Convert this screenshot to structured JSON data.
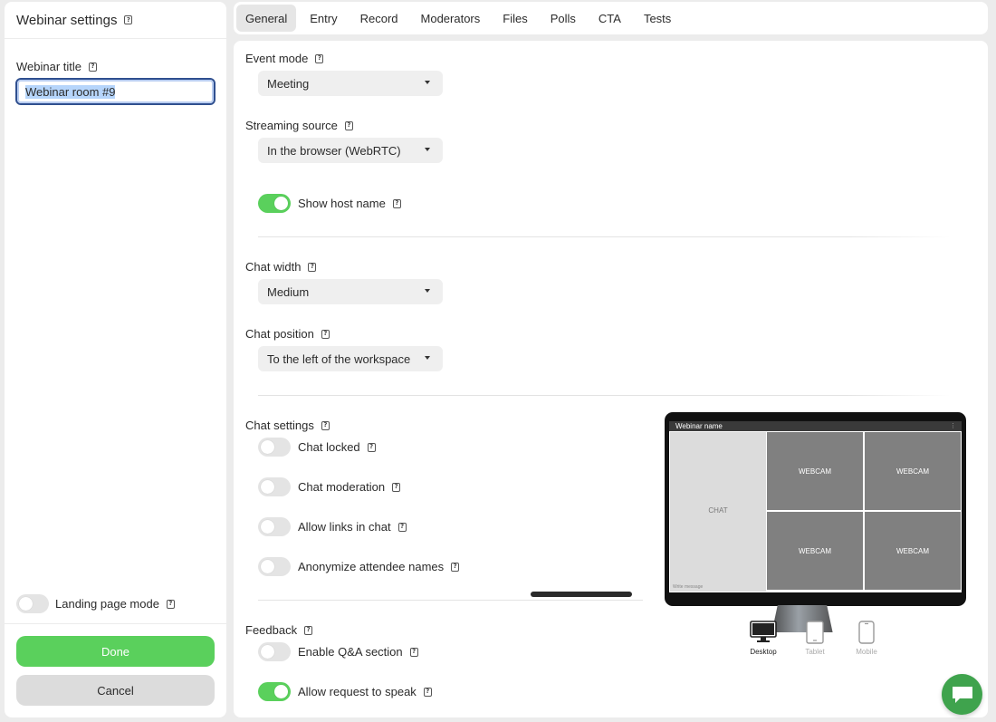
{
  "left": {
    "header_title": "Webinar settings",
    "title_label": "Webinar title",
    "title_value": "Webinar room #9",
    "landing_label": "Landing page mode",
    "done_label": "Done",
    "cancel_label": "Cancel"
  },
  "tabs": [
    {
      "label": "General",
      "active": true
    },
    {
      "label": "Entry"
    },
    {
      "label": "Record"
    },
    {
      "label": "Moderators"
    },
    {
      "label": "Files"
    },
    {
      "label": "Polls"
    },
    {
      "label": "CTA"
    },
    {
      "label": "Tests"
    }
  ],
  "general": {
    "event_mode_label": "Event mode",
    "event_mode_value": "Meeting",
    "streaming_source_label": "Streaming source",
    "streaming_source_value": "In the browser (WebRTC)",
    "show_host_name_label": "Show host name",
    "chat_width_label": "Chat width",
    "chat_width_value": "Medium",
    "chat_position_label": "Chat position",
    "chat_position_value": "To the left of the workspace",
    "chat_settings_label": "Chat settings",
    "chat_locked_label": "Chat locked",
    "chat_moderation_label": "Chat moderation",
    "allow_links_label": "Allow links in chat",
    "anonymize_label": "Anonymize attendee names",
    "feedback_label": "Feedback",
    "qa_label": "Enable Q&A section",
    "request_speak_label": "Allow request to speak"
  },
  "toggles": {
    "landing_page_mode": false,
    "show_host_name": true,
    "chat_locked": false,
    "chat_moderation": false,
    "allow_links": false,
    "anonymize": false,
    "qa": false,
    "request_speak": true
  },
  "preview": {
    "webinar_name": "Webinar name",
    "chat": "CHAT",
    "write_message": "Write message",
    "webcam": "WEBCAM",
    "devices": [
      "Desktop",
      "Tablet",
      "Mobile"
    ]
  },
  "colors": {
    "accent_green": "#5ad05c",
    "fab_green": "#3fa34d",
    "focus_border": "#2f4f8f"
  }
}
